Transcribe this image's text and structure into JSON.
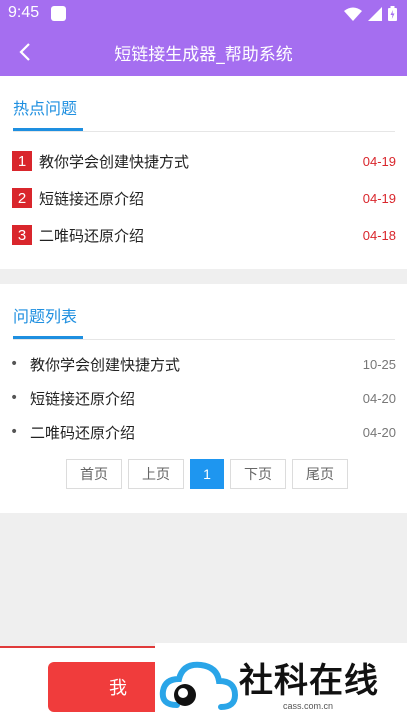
{
  "status_bar": {
    "time": "9:45"
  },
  "app_bar": {
    "title": "短链接生成器_帮助系统"
  },
  "hot_section": {
    "title": "热点问题",
    "items": [
      {
        "rank": "1",
        "title": "教你学会创建快捷方式",
        "date": "04-19"
      },
      {
        "rank": "2",
        "title": "短链接还原介绍",
        "date": "04-19"
      },
      {
        "rank": "3",
        "title": "二唯码还原介绍",
        "date": "04-18"
      }
    ]
  },
  "list_section": {
    "title": "问题列表",
    "bullet": "•",
    "items": [
      {
        "title": "教你学会创建快捷方式",
        "date": "10-25"
      },
      {
        "title": "短链接还原介绍",
        "date": "04-20"
      },
      {
        "title": "二唯码还原介绍",
        "date": "04-20"
      }
    ]
  },
  "pager": {
    "first": "首页",
    "prev": "上页",
    "current": "1",
    "next": "下页",
    "last": "尾页"
  },
  "bottom": {
    "button_label": "我"
  },
  "watermark": {
    "text": "社科在线",
    "url": "cass.com.cn"
  },
  "colors": {
    "accent": "#a56ef0",
    "link_blue": "#1e8fe0",
    "rank_red": "#d9262c",
    "page_active": "#1e96f0"
  }
}
